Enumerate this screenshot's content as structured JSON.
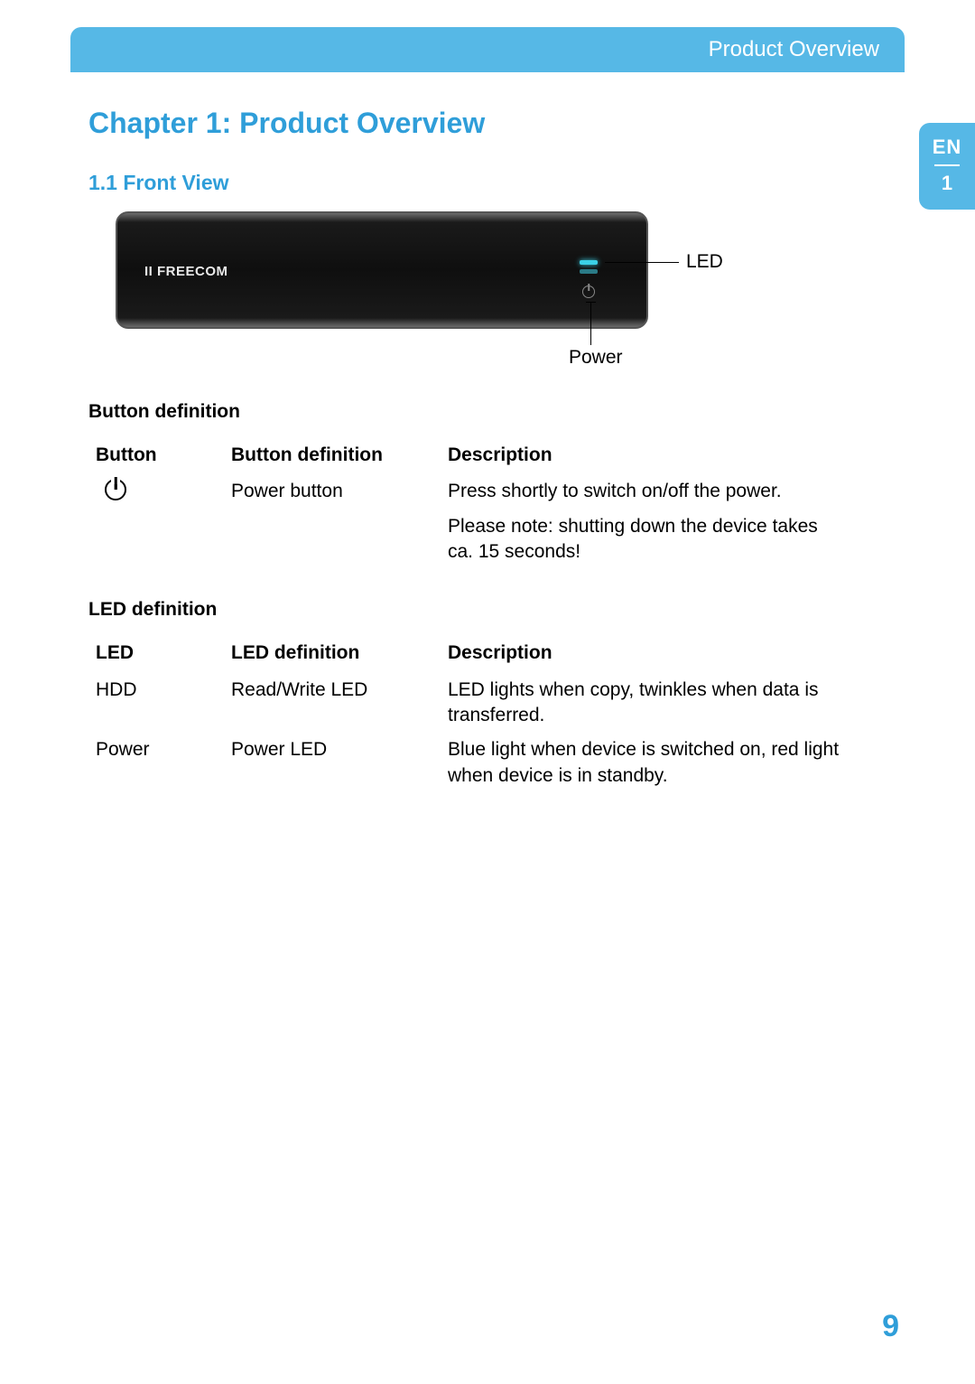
{
  "header": {
    "title": "Product Overview"
  },
  "sidetab": {
    "lang": "EN",
    "chapter": "1"
  },
  "chapter_title": "Chapter 1: Product Overview",
  "section_title": "1.1 Front View",
  "figure": {
    "brand": "II FREECOM",
    "callout_led": "LED",
    "callout_power": "Power"
  },
  "button_section": {
    "heading": "Button definition",
    "columns": {
      "c1": "Button",
      "c2": "Button definition",
      "c3": "Description"
    },
    "rows": [
      {
        "icon": "power-icon",
        "definition": "Power button",
        "description_line1": "Press shortly to switch on/off the power.",
        "description_line2": "Please note: shutting down the device takes ca. 15 seconds!"
      }
    ]
  },
  "led_section": {
    "heading": "LED definition",
    "columns": {
      "c1": "LED",
      "c2": "LED definition",
      "c3": "Description"
    },
    "rows": [
      {
        "name": "HDD",
        "definition": "Read/Write LED",
        "description": "LED lights when copy, twinkles when data is transferred."
      },
      {
        "name": "Power",
        "definition": "Power LED",
        "description": "Blue light when device is switched on, red light when device is in standby."
      }
    ]
  },
  "page_number": "9"
}
